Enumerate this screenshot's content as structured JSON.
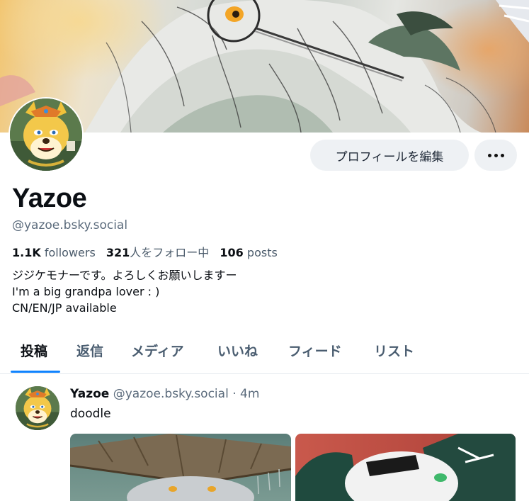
{
  "profile": {
    "display_name": "Yazoe",
    "handle": "@yazoe.bsky.social",
    "stats": {
      "followers_count": "1.1K",
      "followers_label": "followers",
      "following_count": "321",
      "following_label": "人をフォロー中",
      "posts_count": "106",
      "posts_label": "posts"
    },
    "bio_lines": [
      "ジジケモナーです。よろしくお願いしますー",
      "I'm a big grandpa lover : )",
      "CN/EN/JP available"
    ]
  },
  "actions": {
    "edit_profile_label": "プロフィールを編集",
    "more_icon": "ellipsis-icon"
  },
  "tabs": [
    {
      "label": "投稿",
      "active": true
    },
    {
      "label": "返信",
      "active": false
    },
    {
      "label": "メディア",
      "active": false
    },
    {
      "label": "いいね",
      "active": false
    },
    {
      "label": "フィード",
      "active": false
    },
    {
      "label": "リスト",
      "active": false
    }
  ],
  "post": {
    "author": "Yazoe",
    "handle": "@yazoe.bsky.social",
    "separator": "·",
    "time": "4m",
    "text": "doodle"
  },
  "colors": {
    "accent": "#1083fe",
    "button_bg": "#eef1f4",
    "muted_text": "#5b6b7c"
  }
}
